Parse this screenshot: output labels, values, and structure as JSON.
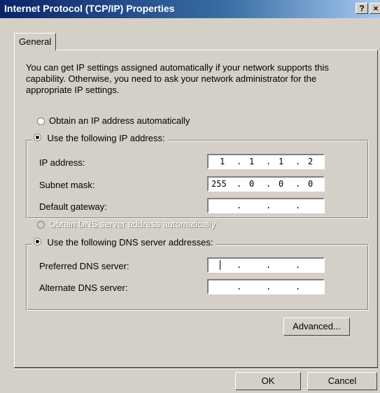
{
  "window": {
    "title": "Internet Protocol (TCP/IP) Properties",
    "help_label": "?",
    "close_label": "×"
  },
  "tabs": [
    {
      "label": "General"
    }
  ],
  "intro": "You can get IP settings assigned automatically if your network supports this capability. Otherwise, you need to ask your network administrator for the appropriate IP settings.",
  "ip": {
    "obtain_auto_label": "Obtain an IP address automatically",
    "use_following_label": "Use the following IP address:",
    "selected": "use_following",
    "fields": {
      "ip_address": {
        "label": "IP address:",
        "octets": [
          "1",
          "1",
          "1",
          "2"
        ]
      },
      "subnet_mask": {
        "label": "Subnet mask:",
        "octets": [
          "255",
          "0",
          "0",
          "0"
        ]
      },
      "default_gateway": {
        "label": "Default gateway:",
        "octets": [
          "",
          "",
          "",
          ""
        ]
      }
    }
  },
  "dns": {
    "obtain_auto_label": "Obtain DNS server address automatically",
    "use_following_label": "Use the following DNS server addresses:",
    "selected": "use_following",
    "fields": {
      "preferred": {
        "label": "Preferred DNS server:",
        "octets": [
          "",
          "",
          "",
          ""
        ]
      },
      "alternate": {
        "label": "Alternate DNS server:",
        "octets": [
          "",
          "",
          "",
          ""
        ]
      }
    }
  },
  "buttons": {
    "advanced": "Advanced...",
    "ok": "OK",
    "cancel": "Cancel"
  }
}
